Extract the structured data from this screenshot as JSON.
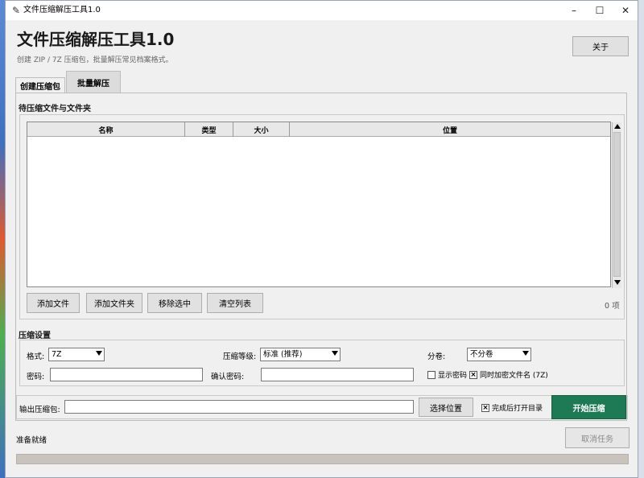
{
  "window": {
    "title": "文件压缩解压工具1.0",
    "controls": {
      "minimize": "–",
      "maximize": "☐",
      "close": "✕"
    }
  },
  "header": {
    "title": "文件压缩解压工具1.0",
    "subtitle": "创建 ZIP / 7Z 压缩包，批量解压常见档案格式。",
    "about_label": "关于"
  },
  "tabs": [
    {
      "label": "创建压缩包",
      "selected": false
    },
    {
      "label": "批量解压",
      "selected": true
    }
  ],
  "files": {
    "section_title": "待压缩文件与文件夹",
    "columns": [
      "名称",
      "类型",
      "大小",
      "位置"
    ],
    "rows": [],
    "buttons": {
      "add_files": "添加文件",
      "add_folder": "添加文件夹",
      "remove_selected": "移除选中",
      "clear_list": "清空列表"
    },
    "count": "0 项"
  },
  "settings": {
    "section_title": "压缩设置",
    "format_label": "格式:",
    "format_value": "7Z",
    "level_label": "压缩等级:",
    "level_value": "标准 (推荐)",
    "split_label": "分卷:",
    "split_value": "不分卷",
    "password_label": "密码:",
    "password_value": "",
    "confirm_label": "确认密码:",
    "confirm_value": "",
    "show_password_label": "显示密码",
    "show_password_checked": false,
    "encrypt_names_label": "同时加密文件名 (7Z)",
    "encrypt_names_checked": true
  },
  "output": {
    "label": "输出压缩包:",
    "value": "",
    "choose_label": "选择位置",
    "open_after_label": "完成后打开目录",
    "open_after_checked": true,
    "start_label": "开始压缩"
  },
  "status": {
    "text": "准备就绪",
    "cancel_label": "取消任务",
    "progress": 0
  },
  "colors": {
    "accent": "#1d7a55",
    "window_bg": "#f0f0f0"
  }
}
